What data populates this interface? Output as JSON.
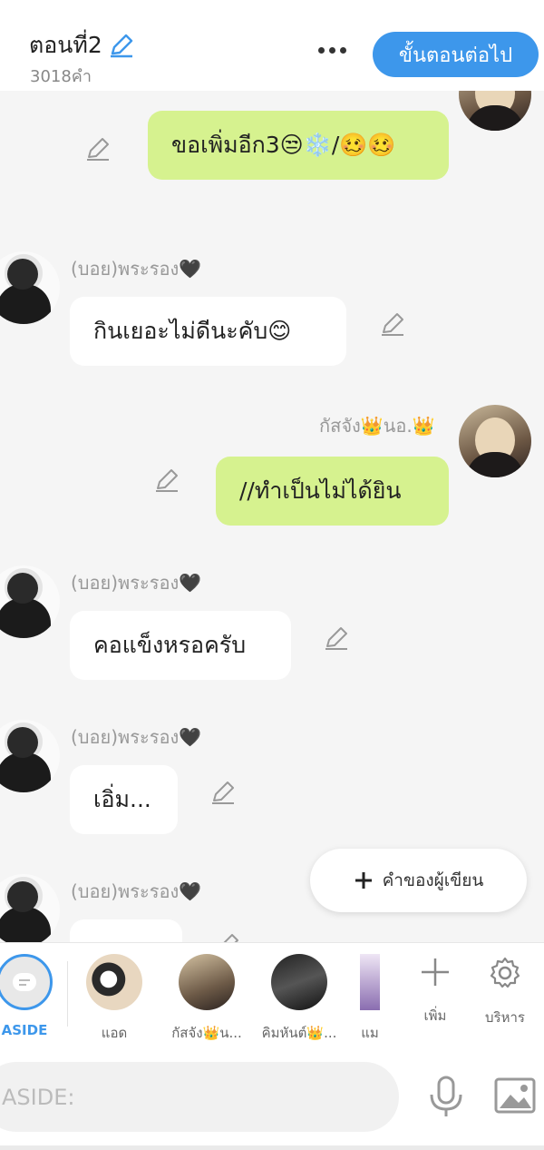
{
  "header": {
    "episode_title": "ตอนที่2",
    "word_count": "3018คำ",
    "next_step_label": "ขั้นตอนต่อไป"
  },
  "messages": [
    {
      "side": "right",
      "speaker": "",
      "text": "ขอเพิ่มอีก3😒❄️/🥴🥴",
      "color": "green"
    },
    {
      "side": "left",
      "speaker": "(บอย)พระรอง🖤",
      "text": "กินเยอะไม่ดีนะคับ😊",
      "color": "white"
    },
    {
      "side": "right",
      "speaker": "กัสจัง👑นอ.👑",
      "text": "//ทำเป็นไม่ได้ยิน",
      "color": "green"
    },
    {
      "side": "left",
      "speaker": "(บอย)พระรอง🖤",
      "text": "คอแข็งหรอครับ",
      "color": "white"
    },
    {
      "side": "left",
      "speaker": "(บอย)พระรอง🖤",
      "text": "เอิ่ม...",
      "color": "white"
    },
    {
      "side": "left",
      "speaker": "(บอย)พระรอง🖤",
      "text": "",
      "color": "white"
    }
  ],
  "writer_note_label": "คำของผู้เขียน",
  "characters": [
    {
      "label": "ASIDE"
    },
    {
      "label": "แอด"
    },
    {
      "label": "กัสจัง👑น..."
    },
    {
      "label": "คิมหันต์👑..."
    },
    {
      "label": "แม"
    }
  ],
  "tools": {
    "add_label": "เพิ่ม",
    "manage_label": "บริหาร"
  },
  "input": {
    "placeholder": "ASIDE:"
  },
  "colors": {
    "accent": "#3d97eb",
    "green_bubble": "#d6f28f",
    "white_bubble": "#ffffff",
    "background": "#f5f5f5"
  }
}
